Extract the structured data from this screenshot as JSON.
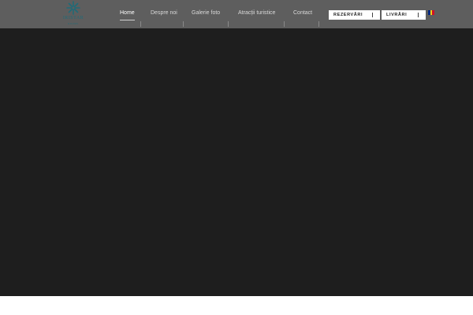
{
  "logo": {
    "brand_text": "IRISTAR",
    "sub_text": "ROOMS"
  },
  "nav": {
    "items": [
      {
        "label": "Home",
        "active": true
      },
      {
        "label": "Despre noi",
        "active": false
      },
      {
        "label": "Galerie foto",
        "active": false
      },
      {
        "label": "Atracții turistice",
        "active": false
      },
      {
        "label": "Contact",
        "active": false
      }
    ]
  },
  "actions": {
    "rezervari_label": "REZERVĂRI",
    "livrari_label": "LIVRĂRI"
  },
  "language": {
    "icon": "romania-flag-icon",
    "colors": [
      "#002b7f",
      "#fcd116",
      "#ce1126"
    ]
  },
  "colors": {
    "header_bg": "#5e5e5e",
    "hero_bg": "#1e1e1e",
    "logo_accent": "#1f6b78"
  }
}
